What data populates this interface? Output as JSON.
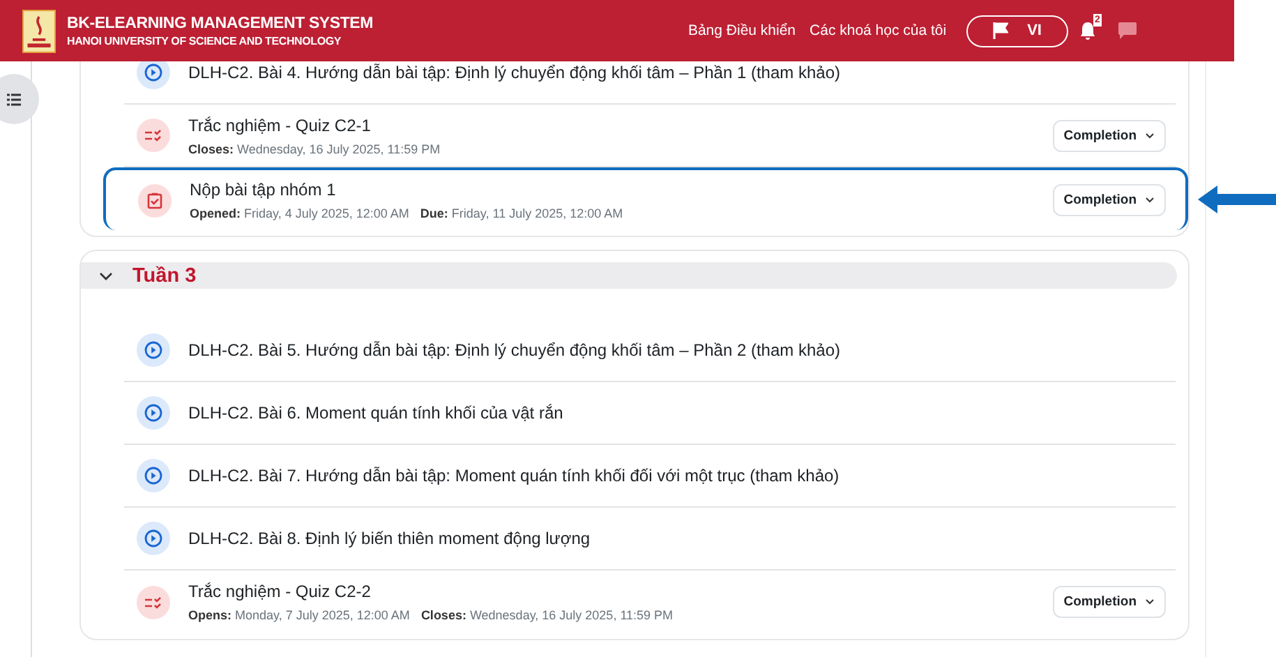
{
  "header": {
    "title": "BK-ELEARNING MANAGEMENT SYSTEM",
    "subtitle": "HANOI UNIVERSITY OF SCIENCE AND TECHNOLOGY",
    "nav": [
      "Bảng Điều khiển",
      "Các khoá học của tôi"
    ],
    "language": "VI",
    "notification_count": "2"
  },
  "sections": [
    {
      "activities": [
        {
          "kind": "video",
          "title": "DLH-C2. Bài 4. Hướng dẫn bài tập: Định lý chuyển động khối tâm – Phần 1 (tham khảo)",
          "highlighted": false
        },
        {
          "kind": "quiz",
          "title": "Trắc nghiệm - Quiz C2-1",
          "dates": [
            "**Closes:** Wednesday, 16 July 2025, 11:59 PM"
          ],
          "completion": "Completion",
          "highlighted": false
        },
        {
          "kind": "assignment",
          "title": "Nộp bài tập nhóm 1",
          "dates": [
            "**Opened:** Friday, 4 July 2025, 12:00 AM",
            "**Due:** Friday, 11 July 2025, 12:00 AM"
          ],
          "completion": "Completion",
          "highlighted": true
        }
      ]
    },
    {
      "title": "Tuần 3",
      "expanded": true,
      "activities": [
        {
          "kind": "video",
          "title": "DLH-C2. Bài 5. Hướng dẫn bài tập: Định lý chuyển động khối tâm – Phần 2 (tham khảo)",
          "highlighted": false
        },
        {
          "kind": "video",
          "title": "DLH-C2. Bài 6. Moment quán tính khối của vật rắn",
          "highlighted": false
        },
        {
          "kind": "video",
          "title": "DLH-C2. Bài 7. Hướng dẫn bài tập: Moment quán tính khối đối với một trục (tham khảo)",
          "highlighted": false
        },
        {
          "kind": "video",
          "title": "DLH-C2. Bài 8. Định lý biến thiên moment động lượng",
          "highlighted": false
        },
        {
          "kind": "quiz",
          "title": "Trắc nghiệm - Quiz C2-2",
          "dates": [
            "**Opens:** Monday, 7 July 2025, 12:00 AM",
            "**Closes:** Wednesday, 16 July 2025, 11:59 PM"
          ],
          "completion": "Completion",
          "highlighted": false
        }
      ]
    }
  ]
}
